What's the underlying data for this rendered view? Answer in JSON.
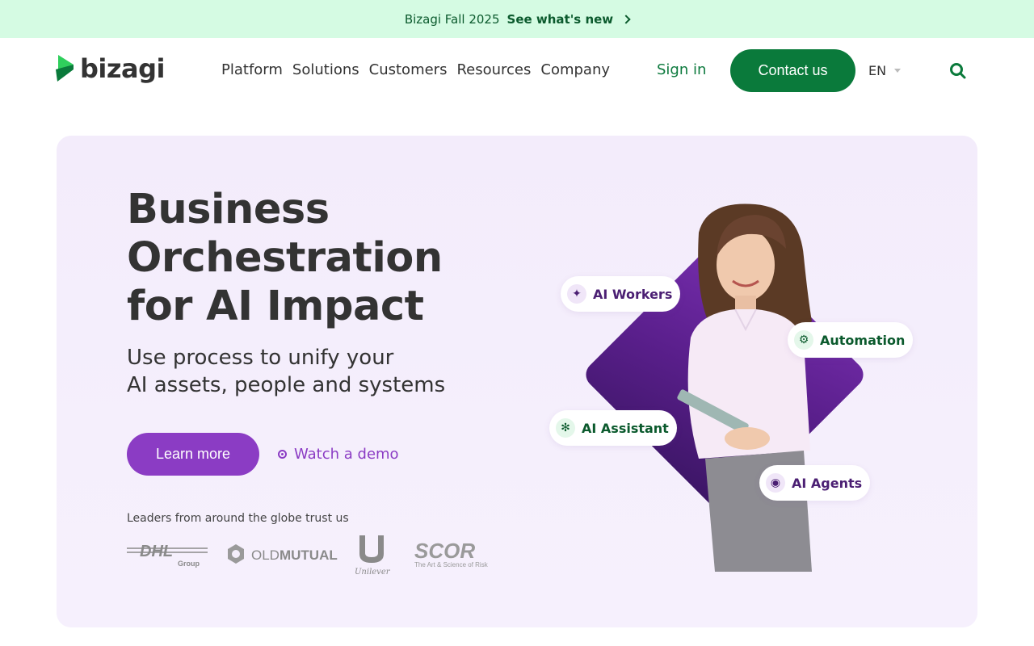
{
  "announcement": {
    "text": "Bizagi Fall 2025",
    "link_label": "See what's new"
  },
  "header": {
    "brand": "bizagi",
    "nav": [
      "Platform",
      "Solutions",
      "Customers",
      "Resources",
      "Company"
    ],
    "sign_in": "Sign in",
    "contact": "Contact us",
    "language": "EN"
  },
  "hero": {
    "title_lines": [
      "Business",
      "Orchestration",
      "for AI Impact"
    ],
    "subtitle_lines": [
      "Use process to unify your",
      "AI assets, people and systems"
    ],
    "primary_cta": "Learn more",
    "secondary_cta": "Watch a demo",
    "trust_text": "Leaders from around the globe trust us",
    "client_logos": {
      "dhl_word": "DHL",
      "dhl_sub": "Group",
      "oldmutual_light": "OLD",
      "oldmutual_bold": "MUTUAL",
      "unilever": "Unilever",
      "scor": "SCOR",
      "scor_tagline": "The Art & Science of Risk"
    },
    "chips": [
      {
        "label": "AI Workers",
        "icon": "sparkle-icon"
      },
      {
        "label": "Automation",
        "icon": "gear-icon"
      },
      {
        "label": "AI Assistant",
        "icon": "asterisk-flower-icon"
      },
      {
        "label": "AI Agents",
        "icon": "agent-icon"
      }
    ]
  },
  "colors": {
    "announcement_bg": "#d5fbe3",
    "brand_green": "#0a7a3b",
    "brand_purple": "#8b3cc4",
    "hero_bg": "#f3ecfb",
    "diamond": "#5a1f8c"
  }
}
